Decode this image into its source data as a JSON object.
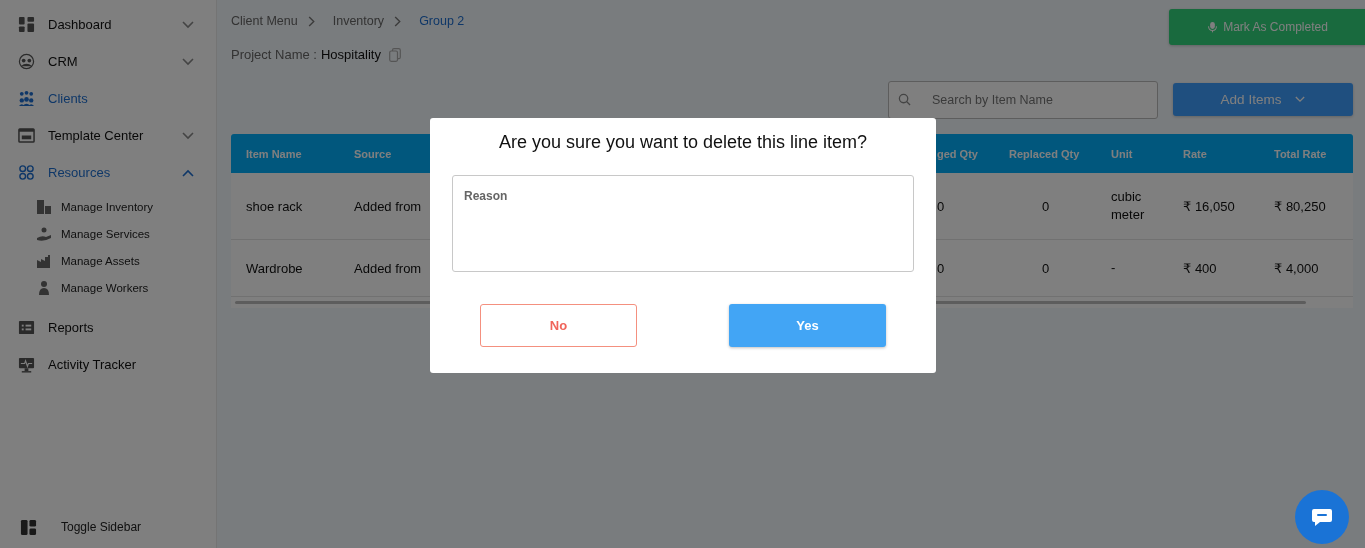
{
  "sidebar": {
    "items": [
      {
        "label": "Dashboard",
        "kind": "group",
        "active": false,
        "expanded": false
      },
      {
        "label": "CRM",
        "kind": "group",
        "active": false,
        "expanded": false
      },
      {
        "label": "Clients",
        "kind": "link",
        "active": true
      },
      {
        "label": "Template Center",
        "kind": "group",
        "active": false,
        "expanded": false
      },
      {
        "label": "Resources",
        "kind": "group",
        "active": true,
        "expanded": true,
        "children": [
          {
            "label": "Manage Inventory"
          },
          {
            "label": "Manage Services"
          },
          {
            "label": "Manage Assets"
          },
          {
            "label": "Manage Workers"
          }
        ]
      },
      {
        "label": "Reports",
        "kind": "link",
        "active": false
      },
      {
        "label": "Activity Tracker",
        "kind": "link",
        "active": false
      }
    ],
    "toggle": "Toggle Sidebar"
  },
  "breadcrumb": [
    {
      "label": "Client Menu",
      "current": false
    },
    {
      "label": "Inventory",
      "current": false
    },
    {
      "label": "Group 2",
      "current": true
    }
  ],
  "project": {
    "label": "Project Name :",
    "value": "Hospitality"
  },
  "mark_completed_button": "Mark As Completed",
  "search": {
    "placeholder": "Search by Item Name"
  },
  "add_items_button": "Add Items",
  "table": {
    "columns": [
      "Item Name",
      "Source",
      "ged Qty",
      "Replaced Qty",
      "Unit",
      "Rate",
      "Total Rate"
    ],
    "rows": [
      [
        "shoe rack",
        "Added from",
        "0",
        "0",
        "cubic meter",
        "₹ 16,050",
        "₹ 80,250"
      ],
      [
        "Wardrobe",
        "Added from",
        "0",
        "0",
        "-",
        "₹ 400",
        "₹ 4,000"
      ]
    ]
  },
  "dialog": {
    "title": "Are you sure you want to delete this line item?",
    "reason": {
      "placeholder": "Reason"
    },
    "no_button": "No",
    "yes_button": "Yes"
  }
}
